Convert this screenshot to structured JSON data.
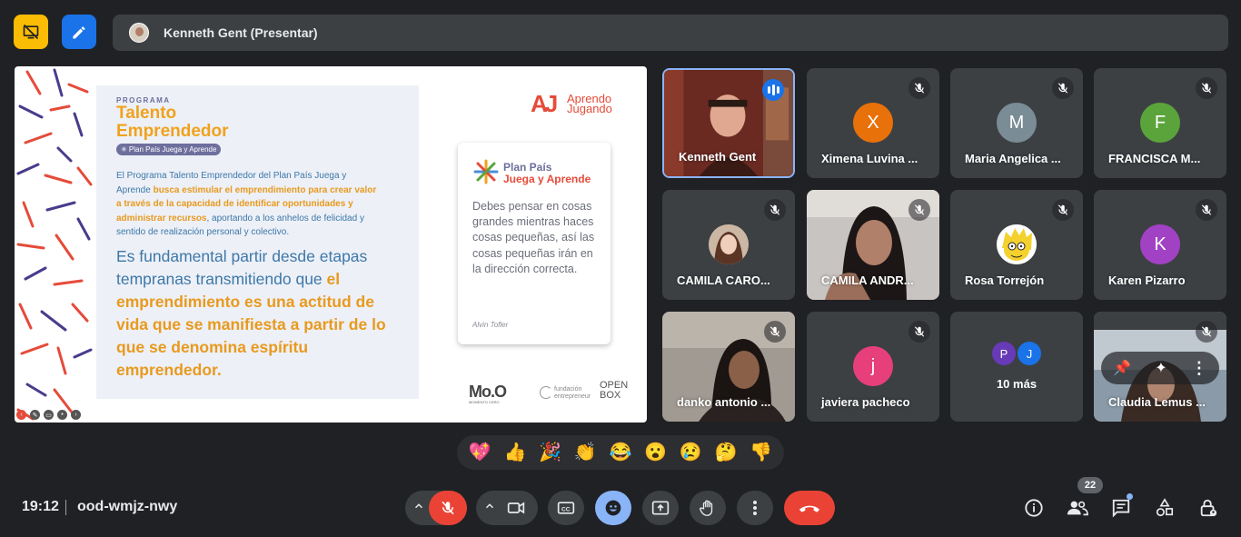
{
  "presenter": {
    "name": "Kenneth Gent (Presentar)"
  },
  "slide": {
    "program_label": "PROGRAMA",
    "program_title_1": "Talento",
    "program_title_2": "Emprendedor",
    "program_pill": "✳ Plan País Juega y Aprende",
    "para_a": "El Programa Talento Emprendedor del Plan País Juega y Aprende ",
    "para_b": "busca estimular el emprendimiento para crear valor a través de la capacidad de identificar oportunidades y administrar recursos",
    "para_c": ", aportando a los anhelos de felicidad y sentido de realización personal y colectivo.",
    "big_a": "Es fundamental partir desde etapas tempranas transmitiendo que ",
    "big_b": "el emprendimiento es una actitud de vida que se manifiesta a partir de lo que se denomina espíritu emprendedor.",
    "brand_mark": "AJ",
    "brand_line1": "Aprendo",
    "brand_line2": "Jugando",
    "plan_line1": "Plan País",
    "plan_line2": "Juega y Aprende",
    "quote": "Debes pensar en cosas grandes mientras haces cosas pequeñas, así las cosas pequeñas irán en la dirección correcta.",
    "quote_author": "Alvin Tofler",
    "logo_moo": "Mo.O",
    "logo_moo_sub": "MOMENTO CERO",
    "logo_fund_1": "fundación",
    "logo_fund_2": "entrepreneur",
    "logo_box_1": "OPEN",
    "logo_box_2": "BOX"
  },
  "participants": [
    {
      "name": "Kenneth Gent",
      "type": "video",
      "speaking": true
    },
    {
      "name": "Ximena Luvina ...",
      "type": "avatar",
      "initial": "X",
      "color": "#e8710a",
      "muted": true
    },
    {
      "name": "Maria Angelica ...",
      "type": "avatar",
      "initial": "M",
      "color": "#7a8c96",
      "muted": true
    },
    {
      "name": "FRANCISCA M...",
      "type": "avatar",
      "initial": "F",
      "color": "#5ba33b",
      "muted": true
    },
    {
      "name": "CAMILA CARO...",
      "type": "photo",
      "muted": true
    },
    {
      "name": "CAMILA ANDR...",
      "type": "video",
      "muted": true
    },
    {
      "name": "Rosa Torrejón",
      "type": "photo",
      "muted": true
    },
    {
      "name": "Karen Pizarro",
      "type": "avatar",
      "initial": "K",
      "color": "#a142c4",
      "muted": true
    },
    {
      "name": "danko antonio ...",
      "type": "video",
      "muted": true
    },
    {
      "name": "javiera pacheco",
      "type": "avatar",
      "initial": "j",
      "color": "#e63f7a",
      "muted": true
    },
    {
      "name": "10 más",
      "type": "more",
      "initials": [
        "P",
        "J"
      ]
    },
    {
      "name": "Claudia Lemus ...",
      "type": "video",
      "muted": true
    }
  ],
  "reactions": [
    "💖",
    "👍",
    "🎉",
    "👏",
    "😂",
    "😮",
    "😢",
    "🤔",
    "👎"
  ],
  "meeting": {
    "time": "19:12",
    "code": "ood-wmjz-nwy"
  },
  "people_count": "22",
  "colors": {
    "bg": "#202124",
    "surface": "#3c4043",
    "end_call": "#ea4335",
    "accent": "#8ab4f8"
  }
}
